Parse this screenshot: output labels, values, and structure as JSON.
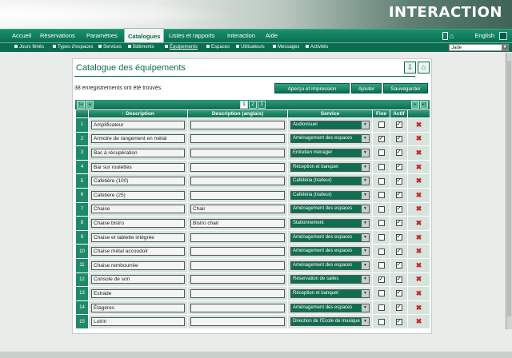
{
  "brand": {
    "logo": "INTERACTION"
  },
  "menu": {
    "items": [
      "Accueil",
      "Réservations",
      "Paramètres",
      "Catalogues",
      "Listes et rapports",
      "Interaction",
      "Aide"
    ],
    "active_index": 3,
    "language": "English"
  },
  "submenu": {
    "items": [
      "Jours fériés",
      "Types d'espaces",
      "Services",
      "Bâtiments",
      "Équipements",
      "Espaces",
      "Utilisateurs",
      "Messages",
      "Activités"
    ],
    "active_index": 4,
    "site": "Jade"
  },
  "panel": {
    "title": "Catalogue des équipements",
    "count_text": "38 enregistrements ont été trouvés.",
    "buttons": {
      "preview": "Aperçu et impression",
      "add": "Ajouter",
      "save": "Sauvegarder"
    }
  },
  "pager": {
    "pages": [
      "1",
      "2",
      "3"
    ],
    "current": "1"
  },
  "table": {
    "headers": {
      "description": "Description",
      "description_en": "Description (anglais)",
      "service": "Service",
      "fixe": "Fixe",
      "actif": "Actif"
    },
    "rows": [
      {
        "num": "1",
        "description": "Amplificateur",
        "description_en": "",
        "service": "Audiovisuel",
        "fixe": false,
        "actif": true
      },
      {
        "num": "2",
        "description": "Armoire de rangement en métal",
        "description_en": "",
        "service": "Aménagement des espaces",
        "fixe": true,
        "actif": true
      },
      {
        "num": "3",
        "description": "Bac à récupération",
        "description_en": "",
        "service": "Entretien ménager",
        "fixe": false,
        "actif": true
      },
      {
        "num": "4",
        "description": "Bar sur roulettes",
        "description_en": "",
        "service": "Réception et banquet",
        "fixe": false,
        "actif": true
      },
      {
        "num": "5",
        "description": "Cafetière (100)",
        "description_en": "",
        "service": "Cafétéria (traiteur)",
        "fixe": false,
        "actif": true
      },
      {
        "num": "6",
        "description": "Cafetière (25)",
        "description_en": "",
        "service": "Cafétéria (traiteur)",
        "fixe": false,
        "actif": true
      },
      {
        "num": "7",
        "description": "Chaise",
        "description_en": "Chair",
        "service": "Aménagement des espaces",
        "fixe": false,
        "actif": true
      },
      {
        "num": "8",
        "description": "Chaise bistro",
        "description_en": "Bistro chair",
        "service": "Stationnement",
        "fixe": false,
        "actif": true
      },
      {
        "num": "9",
        "description": "Chaise et tablette intégrée",
        "description_en": "",
        "service": "Aménagement des espaces",
        "fixe": false,
        "actif": true
      },
      {
        "num": "10",
        "description": "Chaise métal accoudoir",
        "description_en": "",
        "service": "Aménagement des espaces",
        "fixe": false,
        "actif": true
      },
      {
        "num": "11",
        "description": "Chaise rembourrée",
        "description_en": "",
        "service": "Aménagement des espaces",
        "fixe": false,
        "actif": true
      },
      {
        "num": "12",
        "description": "Console de son",
        "description_en": "",
        "service": "Réservation de salles",
        "fixe": true,
        "actif": true
      },
      {
        "num": "13",
        "description": "Estrade",
        "description_en": "",
        "service": "Réception et banquet",
        "fixe": false,
        "actif": true
      },
      {
        "num": "14",
        "description": "Étagères",
        "description_en": "",
        "service": "Aménagement des espaces",
        "fixe": false,
        "actif": true
      },
      {
        "num": "15",
        "description": "Lutrin",
        "description_en": "",
        "service": "Direction de l'École de musique",
        "fixe": false,
        "actif": true
      }
    ]
  },
  "icons": {
    "export": "export-icon",
    "import": "upload-icon",
    "delete": "delete-icon",
    "home": "home-icon"
  }
}
